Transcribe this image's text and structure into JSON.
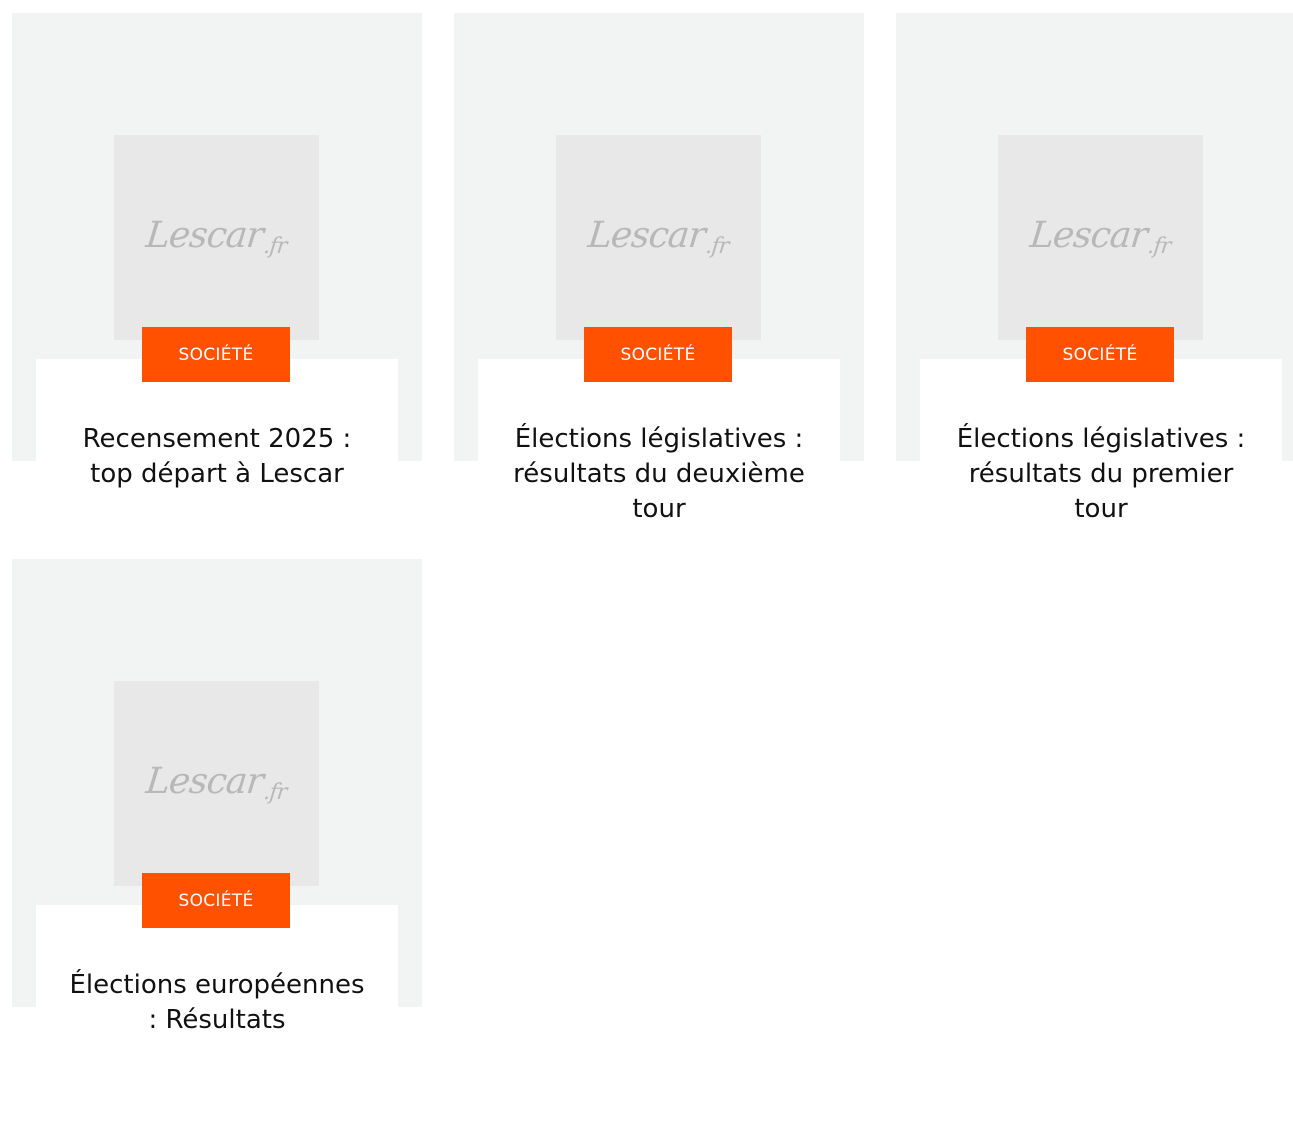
{
  "articles": [
    {
      "category": "SOCIÉTÉ",
      "title": "Recensement 2025 : top départ à Lescar",
      "logo": "Lescar",
      "logo_suffix": ".fr"
    },
    {
      "category": "SOCIÉTÉ",
      "title": "Élections législatives : résultats du deuxième tour",
      "logo": "Lescar",
      "logo_suffix": ".fr"
    },
    {
      "category": "SOCIÉTÉ",
      "title": "Élections législatives : résultats du premier tour",
      "logo": "Lescar",
      "logo_suffix": ".fr"
    },
    {
      "category": "SOCIÉTÉ",
      "title": "Élections européennes : Résultats",
      "logo": "Lescar",
      "logo_suffix": ".fr"
    }
  ],
  "colors": {
    "badge_bg": "#ff5100",
    "card_bg": "#f2f3f3",
    "thumb_bg": "#e8e8e8",
    "logo_text": "#b8b8b8"
  }
}
